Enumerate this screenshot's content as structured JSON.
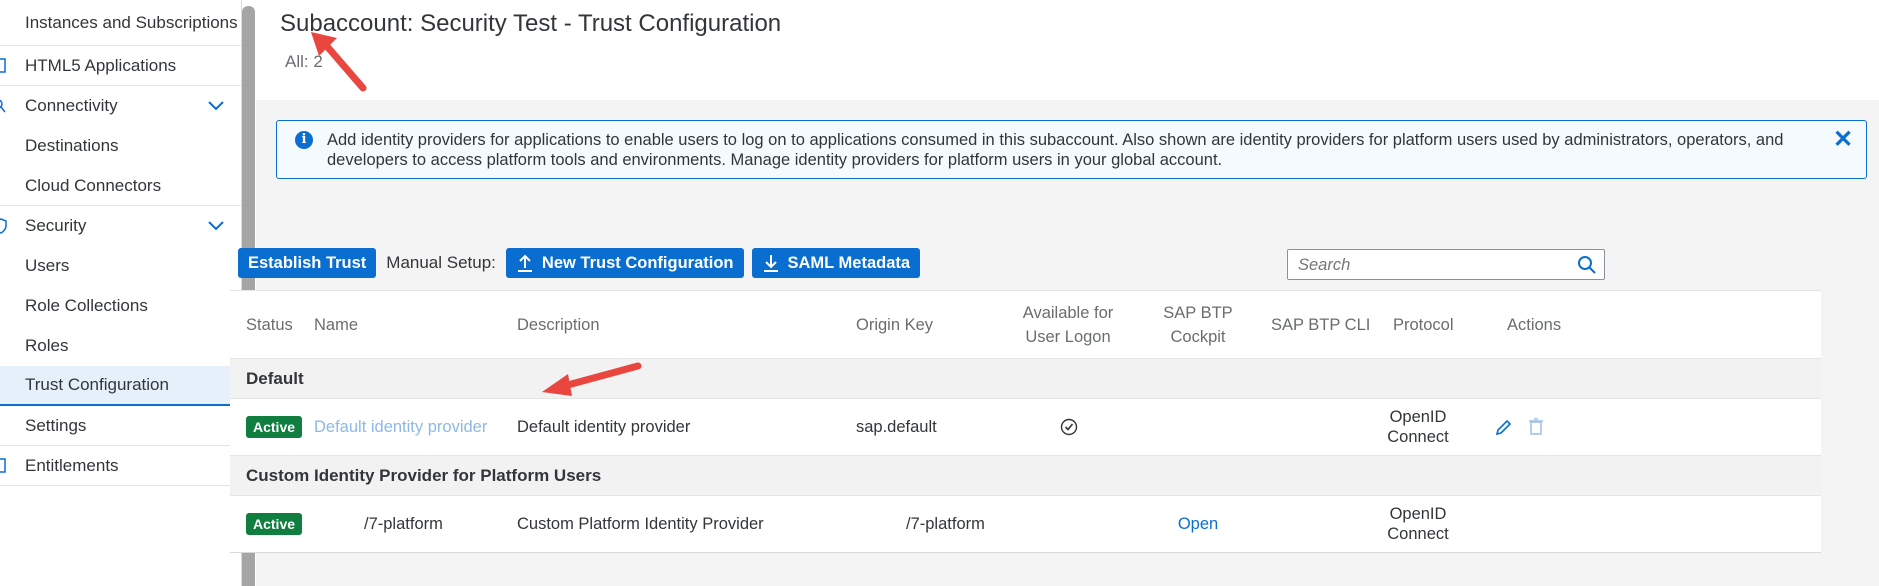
{
  "sidebar": {
    "items": [
      {
        "label": "Instances and Subscriptions"
      },
      {
        "label": "HTML5 Applications"
      },
      {
        "label": "Connectivity"
      },
      {
        "label": "Destinations"
      },
      {
        "label": "Cloud Connectors"
      },
      {
        "label": "Security"
      },
      {
        "label": "Users"
      },
      {
        "label": "Role Collections"
      },
      {
        "label": "Roles"
      },
      {
        "label": "Trust Configuration"
      },
      {
        "label": "Settings"
      },
      {
        "label": "Entitlements"
      }
    ]
  },
  "header": {
    "title": "Subaccount: Security Test - Trust Configuration",
    "count": "All: 2"
  },
  "info": {
    "text": "Add identity providers for applications to enable users to log on to applications consumed in this subaccount. Also shown are identity providers for platform users used by administrators, operators, and developers to access platform tools and environments. Manage identity providers for platform users in your global account."
  },
  "toolbar": {
    "establish_label": "Establish Trust",
    "manual_label": "Manual Setup:",
    "new_trust_label": "New Trust Configuration",
    "saml_label": "SAML Metadata",
    "search_placeholder": "Search"
  },
  "table": {
    "headers": {
      "status": "Status",
      "name": "Name",
      "description": "Description",
      "origin": "Origin Key",
      "available": "Available for User Logon",
      "cockpit": "SAP BTP Cockpit",
      "cli": "SAP BTP CLI",
      "protocol": "Protocol",
      "actions": "Actions"
    },
    "groups": [
      {
        "label": "Default",
        "row": {
          "status": "Active",
          "name": "Default identity provider",
          "description": "Default identity provider",
          "origin": "sap.default",
          "cockpit": "",
          "protocol": "OpenID Connect"
        }
      },
      {
        "label": "Custom Identity Provider for Platform Users",
        "row": {
          "status": "Active",
          "name": "/7-platform",
          "description": "Custom Platform Identity Provider",
          "origin": "/7-platform",
          "cockpit": "Open",
          "protocol": "OpenID Connect"
        }
      }
    ]
  },
  "colors": {
    "accent": "#0a6ed1",
    "active_badge": "#107e3e",
    "annotation_arrow": "#e8463f"
  }
}
